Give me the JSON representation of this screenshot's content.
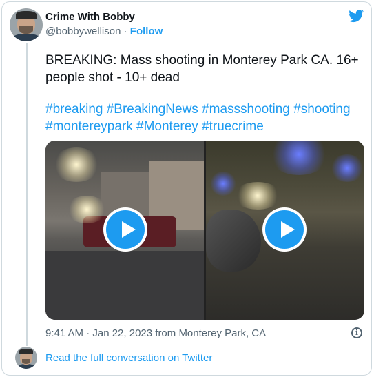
{
  "author": {
    "name": "Crime With Bobby",
    "handle": "@bobbywellison",
    "separator": " · ",
    "follow_label": "Follow"
  },
  "tweet": {
    "text": "BREAKING: Mass shooting in Monterey Park CA. 16+ people shot - 10+ dead",
    "hashtags": "#breaking #BreakingNews #massshooting #shooting #montereypark #Monterey #truecrime"
  },
  "media": {
    "videos": [
      {
        "icon": "play-icon"
      },
      {
        "icon": "play-icon"
      }
    ],
    "accent_color": "#1d9bf0"
  },
  "meta": {
    "timestamp": "9:41 AM · Jan 22, 2023 from Monterey Park, CA",
    "info_icon": "info-icon",
    "info_glyph": "i"
  },
  "footer": {
    "read_label": "Read the full conversation on Twitter"
  },
  "brand": {
    "logo": "twitter-bird-icon",
    "color": "#1d9bf0"
  }
}
